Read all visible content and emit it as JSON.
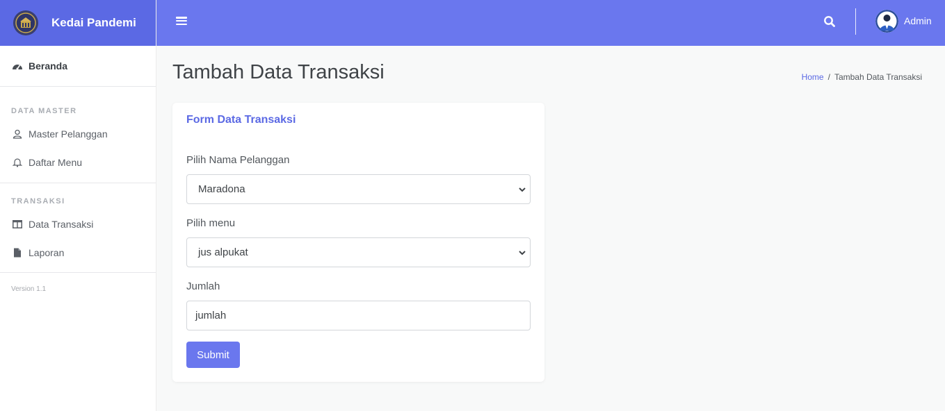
{
  "brand": {
    "name": "Kedai Pandemi",
    "logo_icon": "university-seal-icon"
  },
  "colors": {
    "accent": "#6a77ee",
    "brand_bg": "#5b69e4",
    "link": "#5b69e4"
  },
  "sidebar": {
    "home": {
      "label": "Beranda",
      "icon": "dashboard-icon"
    },
    "sections": [
      {
        "heading": "DATA MASTER",
        "items": [
          {
            "label": "Master Pelanggan",
            "icon": "user-icon"
          },
          {
            "label": "Daftar Menu",
            "icon": "bell-icon"
          }
        ]
      },
      {
        "heading": "TRANSAKSI",
        "items": [
          {
            "label": "Data Transaksi",
            "icon": "table-icon"
          },
          {
            "label": "Laporan",
            "icon": "file-icon"
          }
        ]
      }
    ],
    "version": "Version 1.1"
  },
  "topbar": {
    "user_name": "Admin"
  },
  "page": {
    "title": "Tambah Data Transaksi"
  },
  "breadcrumb": {
    "home": "Home",
    "separator": "/",
    "current": "Tambah Data Transaksi"
  },
  "form": {
    "title": "Form Data Transaksi",
    "pelanggan": {
      "label": "Pilih Nama Pelanggan",
      "selected": "Maradona"
    },
    "menu": {
      "label": "Pilih menu",
      "selected": "jus alpukat"
    },
    "jumlah": {
      "label": "Jumlah",
      "value": "jumlah"
    },
    "submit_label": "Submit"
  }
}
